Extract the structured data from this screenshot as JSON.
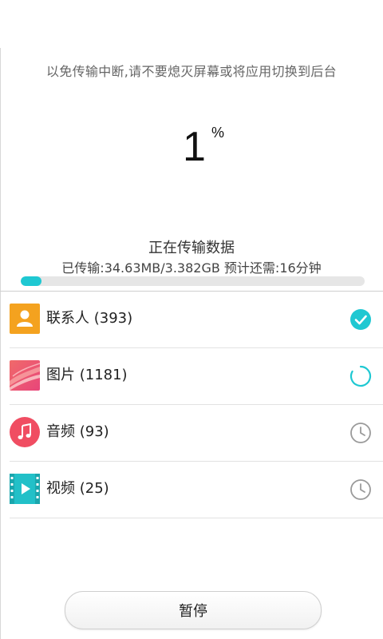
{
  "warning": {
    "text": "以免传输中断,请不要熄灭屏幕或将应用切换到后台"
  },
  "progress": {
    "percent_value": "1",
    "percent_sign": "%",
    "fraction": 0.01,
    "title": "正在传输数据",
    "detail": "已传输:34.63MB/3.382GB 预计还需:16分钟",
    "accent_color": "#1fc8d2"
  },
  "items": [
    {
      "label": "联系人 (393)",
      "icon": "contacts-icon",
      "status": "done",
      "status_icon": "check-circle-icon"
    },
    {
      "label": "图片 (1181)",
      "icon": "photos-icon",
      "status": "in-progress",
      "status_icon": "spinner-icon"
    },
    {
      "label": "音频 (93)",
      "icon": "music-icon",
      "status": "waiting",
      "status_icon": "clock-icon"
    },
    {
      "label": "视频 (25)",
      "icon": "video-icon",
      "status": "waiting",
      "status_icon": "clock-icon"
    }
  ],
  "pause_button": {
    "label": "暂停"
  }
}
